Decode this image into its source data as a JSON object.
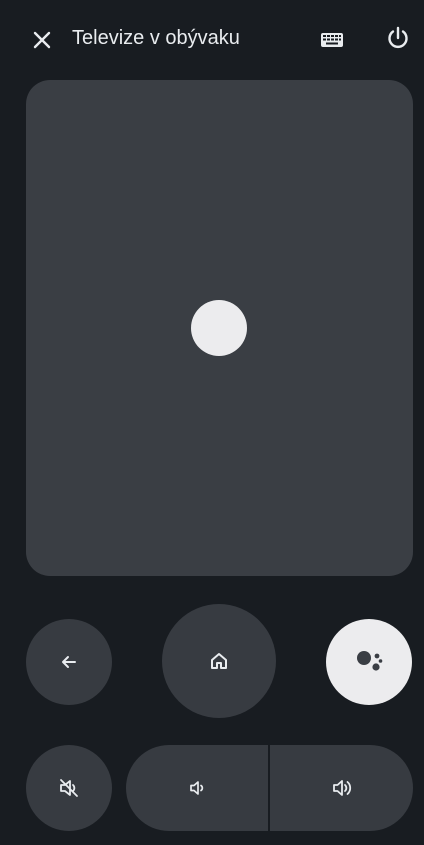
{
  "header": {
    "title": "Televize v obývaku",
    "close_icon": "close-icon",
    "keyboard_icon": "keyboard-icon",
    "power_icon": "power-icon"
  },
  "controls": {
    "back_icon": "arrow-left-icon",
    "home_icon": "home-icon",
    "assistant_icon": "google-assistant-icon",
    "mute_icon": "volume-off-icon",
    "volume_down_icon": "volume-down-icon",
    "volume_up_icon": "volume-up-icon"
  },
  "colors": {
    "background": "#181c21",
    "surface": "#373b41",
    "touchpad": "#3a3e44",
    "text": "#e9ecef",
    "accent_light": "#ececee"
  }
}
